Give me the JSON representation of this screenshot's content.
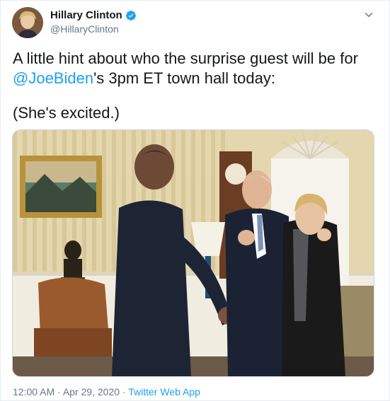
{
  "author": {
    "name": "Hillary Clinton",
    "handle": "@HillaryClinton"
  },
  "tweet": {
    "text_before": "A little hint about who the surprise guest will be for ",
    "mention": "@JoeBiden",
    "text_after": "'s 3pm ET town hall today:",
    "text_line2": "(She's excited.)"
  },
  "meta": {
    "time": "12:00 AM",
    "sep1": " · ",
    "date": "Apr 29, 2020",
    "sep2": " · ",
    "app": "Twitter Web App"
  },
  "icons": {
    "verified": "verified-badge-icon",
    "caret": "chevron-down-icon"
  },
  "colors": {
    "accent": "#1da1f2",
    "text": "#14171a",
    "secondary": "#657786"
  }
}
